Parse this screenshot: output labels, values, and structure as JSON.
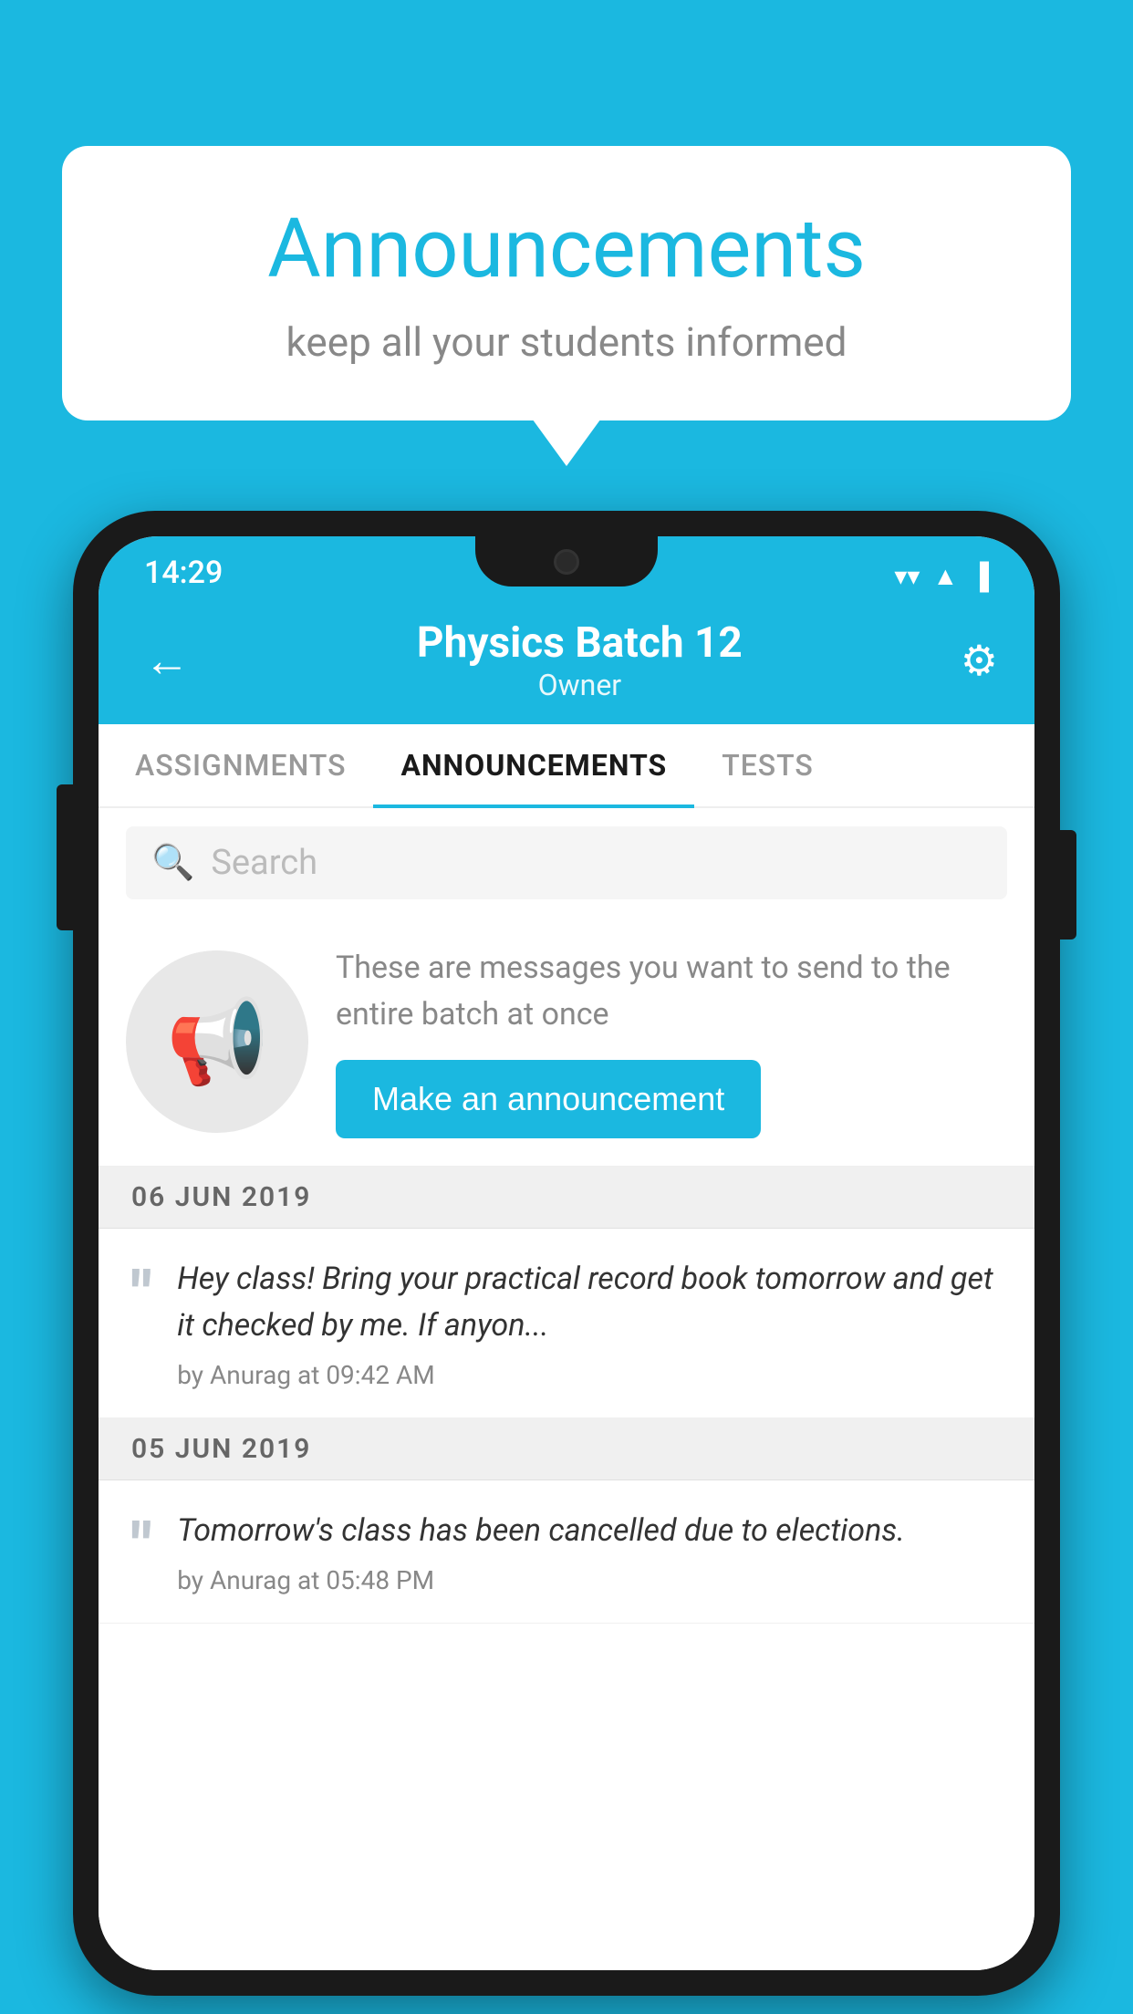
{
  "background_color": "#1BB8E0",
  "speech_bubble": {
    "title": "Announcements",
    "subtitle": "keep all your students informed"
  },
  "phone": {
    "status_bar": {
      "time": "14:29",
      "wifi": "▼",
      "signal": "▲",
      "battery": "▐"
    },
    "header": {
      "back_label": "←",
      "title": "Physics Batch 12",
      "subtitle": "Owner",
      "settings_label": "⚙"
    },
    "tabs": [
      {
        "label": "ASSIGNMENTS",
        "active": false
      },
      {
        "label": "ANNOUNCEMENTS",
        "active": true
      },
      {
        "label": "TESTS",
        "active": false
      },
      {
        "label": "...",
        "active": false
      }
    ],
    "search": {
      "placeholder": "Search"
    },
    "promo": {
      "description": "These are messages you want to send to the entire batch at once",
      "button_label": "Make an announcement"
    },
    "announcements": [
      {
        "date": "06  JUN  2019",
        "message": "Hey class! Bring your practical record book tomorrow and get it checked by me. If anyon...",
        "meta": "by Anurag at 09:42 AM"
      },
      {
        "date": "05  JUN  2019",
        "message": "Tomorrow's class has been cancelled due to elections.",
        "meta": "by Anurag at 05:48 PM"
      }
    ]
  }
}
